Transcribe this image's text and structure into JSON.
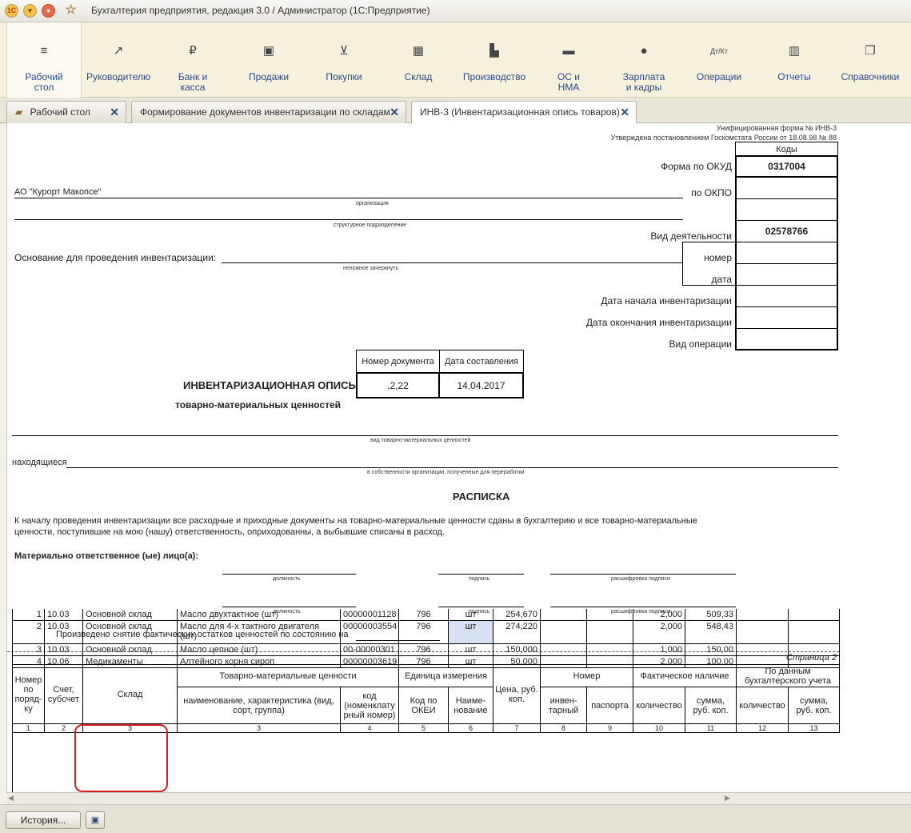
{
  "window": {
    "title": "Бухгалтерия предприятия, редакция 3.0 / Администратор  (1С:Предприятие)"
  },
  "nav": [
    {
      "label": "Рабочий\nстол",
      "icon": "menu-icon"
    },
    {
      "label": "Руководителю",
      "icon": "chart-line-icon"
    },
    {
      "label": "Банк и\nкасса",
      "icon": "ruble-icon"
    },
    {
      "label": "Продажи",
      "icon": "bag-icon"
    },
    {
      "label": "Покупки",
      "icon": "cart-icon"
    },
    {
      "label": "Склад",
      "icon": "grid-icon"
    },
    {
      "label": "Производство",
      "icon": "factory-icon"
    },
    {
      "label": "ОС и\nНМА",
      "icon": "truck-icon"
    },
    {
      "label": "Зарплата\nи кадры",
      "icon": "person-icon"
    },
    {
      "label": "Операции",
      "icon": "debit-credit-icon"
    },
    {
      "label": "Отчеты",
      "icon": "bar-chart-icon"
    },
    {
      "label": "Справочники",
      "icon": "books-icon"
    }
  ],
  "tabs": [
    {
      "label": "Рабочий стол"
    },
    {
      "label": "Формирование документов инвентаризации по складам"
    },
    {
      "label": "ИНВ-3 (Инвентаризационная опись товаров)"
    }
  ],
  "form": {
    "unified_form": "Унифицированная форма № ИНВ-3",
    "approved": "Утверждена постановлением Госкомстата России от 18.08.98 № 88",
    "codes": "Коды",
    "okud_label": "Форма по ОКУД",
    "okud": "0317004",
    "okpo_label": "по ОКПО",
    "activity_label": "Вид деятельности",
    "activity": "02578766",
    "organization": "АО \"Курорт Макопсе\"",
    "org_caption": "организация",
    "struct_caption": "структурное подразделение",
    "basis_label": "Основание для проведения инвентаризации:",
    "basis_caption": "ненужное зачеркнуть",
    "number_label": "номер",
    "date_label": "дата",
    "start_label": "Дата начала инвентаризации",
    "end_label": "Дата окончания инвентаризации",
    "op_label": "Вид операции",
    "doc_num_label": "Номер документа",
    "doc_date_label": "Дата составления",
    "doc_num": ",2,22",
    "doc_date": "14.04.2017",
    "title": "ИНВЕНТАРИЗАЦИОННАЯ ОПИСЬ",
    "subtitle": "товарно-материальных ценностей",
    "kind_caption": "вид товарно-материальных ценностей",
    "located": "находящиеся",
    "located_caption": "в собственности организации, полученные для переработки",
    "receipt_title": "РАСПИСКА",
    "receipt_text1": "К началу проведения инвентаризации все расходные и приходные документы на товарно-материальные ценности сданы в бухгалтерию и все товарно-материальные",
    "receipt_text2": "ценности, поступившие на мою (нашу) ответственность, оприходованны, а выбывшие списаны в расход.",
    "responsible": "Материально ответственное (ые) лицо(а):",
    "position": "должность",
    "signature": "подпись",
    "decode": "расшифровка подписи",
    "performed": "Произведено снятие фактических остатков ценностей по состоянию на",
    "page": "Страница 2"
  },
  "table": {
    "h_num": "Номер по поряд- ку",
    "h_account": "Счет, субсчет",
    "h_warehouse": "Склад",
    "h_tmc": "Товарно-материальные ценности",
    "h_name": "наименование, характеристика (вид, сорт, группа)",
    "h_code": "код (номенклату рный номер)",
    "h_unit": "Единица измерения",
    "h_okei": "Код по ОКЕИ",
    "h_unitname": "Наиме- нование",
    "h_price": "Цена, руб. коп.",
    "h_number": "Номер",
    "h_inv": "инвен- тарный",
    "h_passport": "паспорта",
    "h_fact": "Фактическое наличие",
    "h_qty": "количество",
    "h_sum": "сумма, руб. коп.",
    "h_acc": "По данным бухгалтерского учета",
    "h_acc_qty": "количество",
    "h_acc_sum": "сумма, руб. коп.",
    "colnums": [
      "1",
      "2",
      "3",
      "4",
      "5",
      "6",
      "7",
      "8",
      "9",
      "10",
      "11",
      "12",
      "13"
    ],
    "rows": [
      {
        "n": "1",
        "acc": "10.03",
        "wh": "Основной склад",
        "name": "Масло  двухтактное (шт)",
        "code": "00000001128",
        "okei": "796",
        "unit": "шт",
        "price": "254,670",
        "qty": "2,000",
        "sum": "509,33"
      },
      {
        "n": "2",
        "acc": "10.03",
        "wh": "Основной склад",
        "name": "Масло для 4-х тактного двигателя (шт)",
        "code": "00000003554",
        "okei": "796",
        "unit": "шт",
        "price": "274,220",
        "qty": "2,000",
        "sum": "548,43"
      },
      {
        "n": "3",
        "acc": "10.03",
        "wh": "Основной склад",
        "name": "Масло цепное (шт)",
        "code": "00-00000301",
        "okei": "796",
        "unit": "шт",
        "price": "150,000",
        "qty": "1,000",
        "sum": "150,00"
      },
      {
        "n": "4",
        "acc": "10.06",
        "wh": "Медикаменты",
        "name": "Алтейного корня сироп",
        "code": "00000003619",
        "okei": "796",
        "unit": "шт",
        "price": "50,000",
        "qty": "2,000",
        "sum": "100,00"
      }
    ]
  },
  "bottom": {
    "history": "История..."
  }
}
